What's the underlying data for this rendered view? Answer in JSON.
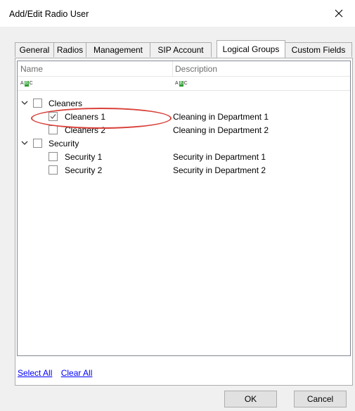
{
  "window": {
    "title": "Add/Edit Radio User",
    "close_icon": "×"
  },
  "tabs": [
    {
      "label": "General"
    },
    {
      "label": "Radios"
    },
    {
      "label": "Management"
    },
    {
      "label": "SIP Account"
    },
    {
      "label": "Logical Groups",
      "active": true
    },
    {
      "label": "Custom Fields"
    }
  ],
  "grid": {
    "columns": {
      "name": "Name",
      "description": "Description"
    },
    "filter_icon": "abc-filter-icon",
    "rows": [
      {
        "label": "Cleaners",
        "description": "",
        "level": 0,
        "expanded": true,
        "checked": false
      },
      {
        "label": "Cleaners 1",
        "description": "Cleaning in Department 1",
        "level": 1,
        "checked": true
      },
      {
        "label": "Cleaners 2",
        "description": "Cleaning in Department 2",
        "level": 1,
        "checked": false
      },
      {
        "label": "Security",
        "description": "",
        "level": 0,
        "expanded": true,
        "checked": false
      },
      {
        "label": "Security 1",
        "description": "Security in Department 1",
        "level": 1,
        "checked": false
      },
      {
        "label": "Security 2",
        "description": "Security in Department 2",
        "level": 1,
        "checked": false
      }
    ]
  },
  "links": {
    "select_all": "Select All",
    "clear_all": "Clear All"
  },
  "buttons": {
    "ok": "OK",
    "cancel": "Cancel"
  },
  "colors": {
    "accent_link": "#0000ff",
    "highlight": "#d9413a"
  }
}
